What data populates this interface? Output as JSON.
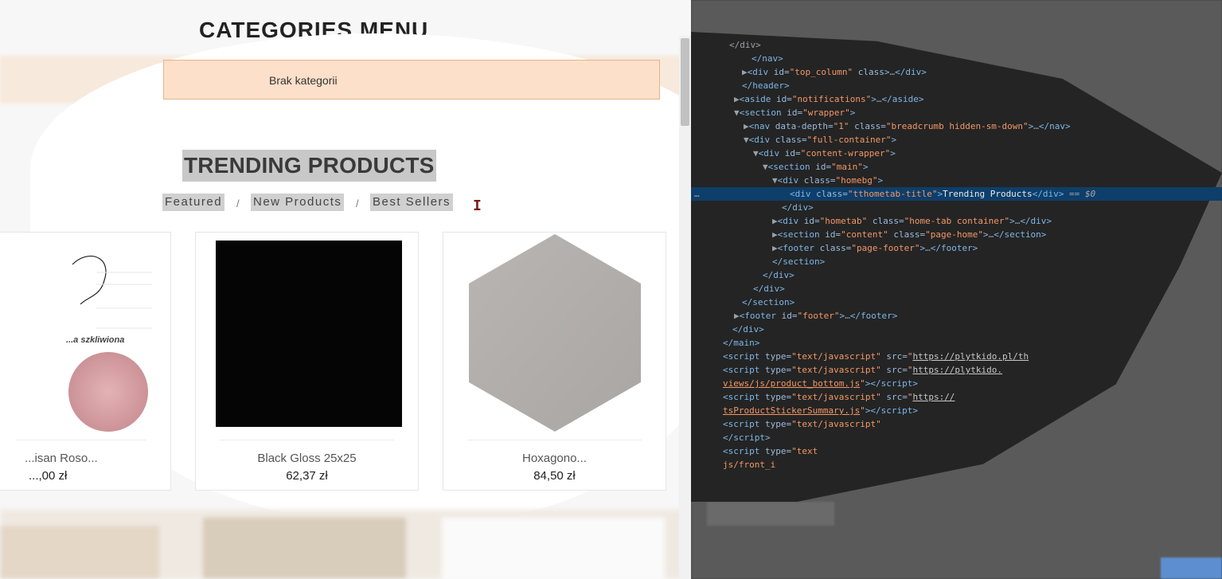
{
  "site": {
    "categories_title": "CATEGORIES MENU",
    "no_categories": "Brak kategorii",
    "trending_title": "TRENDING PRODUCTS",
    "tabs": [
      "Featured",
      "New Products",
      "Best Sellers"
    ],
    "tab_separator": "/",
    "cursor_glyph": "I",
    "products": [
      {
        "name": "...isan Roso...",
        "price": "...,00 zł",
        "image_caption": "...a szkliwiona"
      },
      {
        "name": "Black Gloss 25x25",
        "price": "62,37 zł"
      },
      {
        "name": "Hoxagono...",
        "price": "84,50 zł"
      }
    ]
  },
  "devtools": {
    "lines": [
      {
        "indent": 48,
        "html": "&lt;/div&gt;",
        "sel": false
      },
      {
        "indent": 76,
        "html": "<span class='tag'>&lt;/nav&gt;</span>"
      },
      {
        "indent": 64,
        "html": "▶<span class='tag'>&lt;div</span> <span class='attr'>id=</span><span class='val'>\"top_column\"</span> <span class='attr'>class</span><span class='tag'>&gt;</span>…<span class='tag'>&lt;/div&gt;</span>"
      },
      {
        "indent": 64,
        "html": "<span class='tag'>&lt;/header&gt;</span>"
      },
      {
        "indent": 54,
        "html": "▶<span class='tag'>&lt;aside</span> <span class='attr'>id=</span><span class='val'>\"notifications\"</span><span class='tag'>&gt;</span>…<span class='tag'>&lt;/aside&gt;</span>"
      },
      {
        "indent": 54,
        "html": "▼<span class='tag'>&lt;section</span> <span class='attr'>id=</span><span class='val'>\"wrapper\"</span><span class='tag'>&gt;</span>"
      },
      {
        "indent": 66,
        "html": "▶<span class='tag'>&lt;nav</span> <span class='attr'>data-depth=</span><span class='val'>\"1\"</span> <span class='attr'>class=</span><span class='val'>\"breadcrumb hidden-sm-down\"</span><span class='tag'>&gt;</span>…<span class='tag'>&lt;/nav&gt;</span>"
      },
      {
        "indent": 66,
        "html": "▼<span class='tag'>&lt;div</span> <span class='attr'>class=</span><span class='val'>\"full-container\"</span><span class='tag'>&gt;</span>"
      },
      {
        "indent": 78,
        "html": "▼<span class='tag'>&lt;div</span> <span class='attr'>id=</span><span class='val'>\"content-wrapper\"</span><span class='tag'>&gt;</span>"
      },
      {
        "indent": 90,
        "html": "▼<span class='tag'>&lt;section</span> <span class='attr'>id=</span><span class='val'>\"main\"</span><span class='tag'>&gt;</span>"
      },
      {
        "indent": 102,
        "html": "▼<span class='tag'>&lt;div</span> <span class='attr'>class=</span><span class='val'>\"homebg\"</span><span class='tag'>&gt;</span>"
      },
      {
        "indent": 124,
        "html": "<span class='tag'>&lt;div</span> <span class='attr'>class=</span><span class='val'>\"tthometab-title\"</span><span class='tag'>&gt;</span><span class='txt'>Trending Products</span><span class='tag'>&lt;/div&gt;</span> == <span style='color:#aaa;font-style:italic'>$0</span>",
        "sel": true
      },
      {
        "indent": 114,
        "html": "<span class='tag'>&lt;/div&gt;</span>"
      },
      {
        "indent": 102,
        "html": "▶<span class='tag'>&lt;div</span> <span class='attr'>id=</span><span class='val'>\"hometab\"</span> <span class='attr'>class=</span><span class='val'>\"home-tab container\"</span><span class='tag'>&gt;</span>…<span class='tag'>&lt;/div&gt;</span>"
      },
      {
        "indent": 102,
        "html": "▶<span class='tag'>&lt;section</span> <span class='attr'>id=</span><span class='val'>\"content\"</span> <span class='attr'>class=</span><span class='val'>\"page-home\"</span><span class='tag'>&gt;</span>…<span class='tag'>&lt;/section&gt;</span>"
      },
      {
        "indent": 102,
        "html": "▶<span class='tag'>&lt;footer</span> <span class='attr'>class=</span><span class='val'>\"page-footer\"</span><span class='tag'>&gt;</span>…<span class='tag'>&lt;/footer&gt;</span>"
      },
      {
        "indent": 102,
        "html": "<span class='tag'>&lt;/section&gt;</span>"
      },
      {
        "indent": 90,
        "html": "<span class='tag'>&lt;/div&gt;</span>"
      },
      {
        "indent": 78,
        "html": "<span class='tag'>&lt;/div&gt;</span>"
      },
      {
        "indent": 64,
        "html": "<span class='tag'>&lt;/section&gt;</span>"
      },
      {
        "indent": 54,
        "html": "▶<span class='tag'>&lt;footer</span> <span class='attr'>id=</span><span class='val'>\"footer\"</span><span class='tag'>&gt;</span>…<span class='tag'>&lt;/footer&gt;</span>"
      },
      {
        "indent": 52,
        "html": "<span class='tag'>&lt;/div&gt;</span>"
      },
      {
        "indent": 40,
        "html": "<span class='tag'>&lt;/main&gt;</span>"
      },
      {
        "indent": 40,
        "html": "<span class='tag'>&lt;script</span> <span class='attr'>type=</span><span class='val'>\"text/javascript\"</span> <span class='attr'>src=</span><span class='val'>\"<span class='link'>https://plytkido.pl/th</span></span>"
      },
      {
        "indent": 40,
        "html": "<span class='tag'>&lt;script</span> <span class='attr'>type=</span><span class='val'>\"text/javascript\"</span> <span class='attr'>src=</span><span class='val'>\"<span class='link'>https://plytkido.</span></span>"
      },
      {
        "indent": 40,
        "html": "<span class='link' style='color:#f29766'>views/js/product_bottom.js</span><span class='val'>\"</span><span class='tag'>&gt;&lt;/script&gt;</span>"
      },
      {
        "indent": 40,
        "html": "<span class='tag'>&lt;script</span> <span class='attr'>type=</span><span class='val'>\"text/javascript\"</span> <span class='attr'>src=</span><span class='val'>\"<span class='link'>https://</span></span>"
      },
      {
        "indent": 40,
        "html": "<span class='link' style='color:#f29766'>tsProductStickerSummary.js</span><span class='val'>\"</span><span class='tag'>&gt;&lt;/script&gt;</span>"
      },
      {
        "indent": 40,
        "html": "<span class='tag'>&lt;script</span> <span class='attr'>type=</span><span class='val'>\"text/javascript\"</span>"
      },
      {
        "indent": 40,
        "html": "<span class='tag'>&lt;/script&gt;</span>"
      },
      {
        "indent": 40,
        "html": "<span class='tag'>&lt;script</span> <span class='attr'>type=</span><span class='val'>\"text</span>"
      },
      {
        "indent": 40,
        "html": "<span class='val'>js/front_i</span>"
      }
    ]
  }
}
